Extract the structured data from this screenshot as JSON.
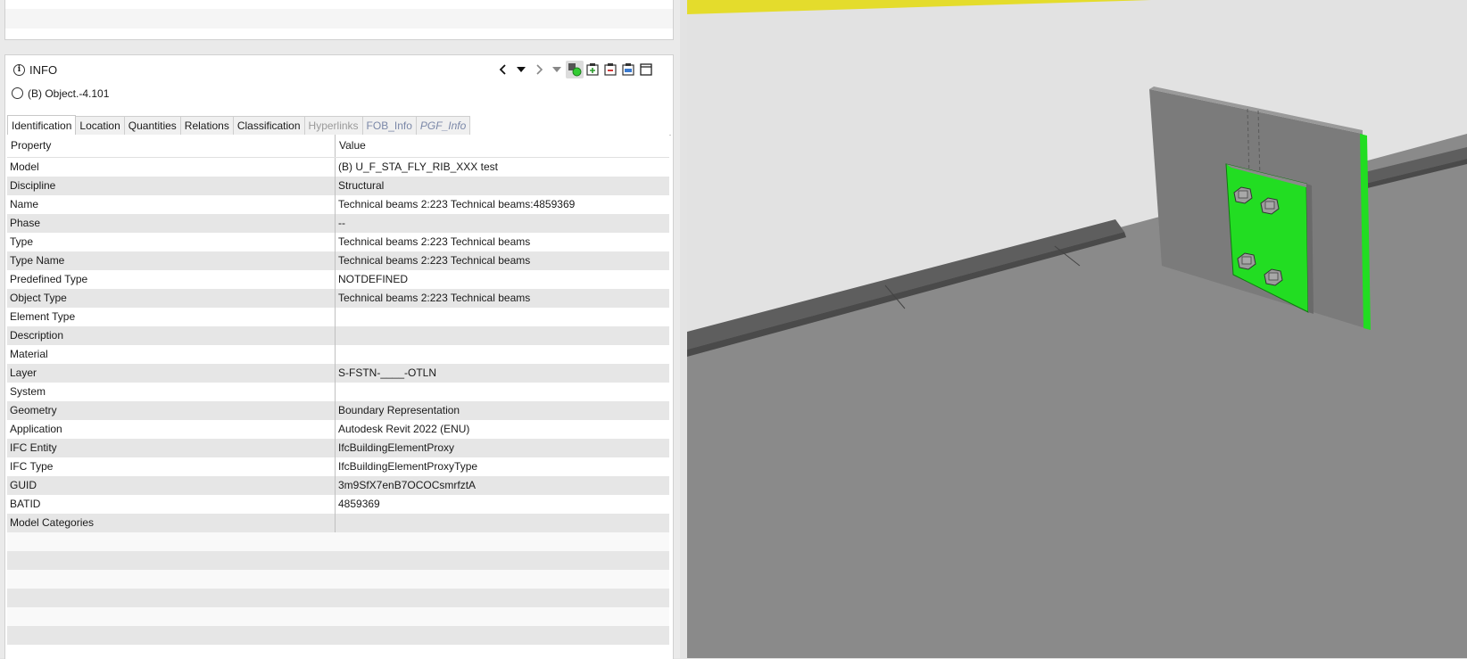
{
  "info_panel": {
    "title": "INFO",
    "object_label": "(B) Object.-4.101",
    "tabs": [
      {
        "label": "Identification"
      },
      {
        "label": "Location"
      },
      {
        "label": "Quantities"
      },
      {
        "label": "Relations"
      },
      {
        "label": "Classification"
      },
      {
        "label": "Hyperlinks"
      },
      {
        "label": "FOB_Info"
      },
      {
        "label": "PGF_Info"
      }
    ],
    "toolbar_icons": [
      "chevron-left-icon",
      "dropdown-arrow-icon",
      "chevron-right-icon",
      "dropdown-arrow-icon",
      "select-objects-icon",
      "add-to-set-icon",
      "remove-from-set-icon",
      "clear-set-icon",
      "window-icon"
    ]
  },
  "grid": {
    "headers": {
      "property": "Property",
      "value": "Value"
    },
    "rows": [
      {
        "property": "Model",
        "value": "(B) U_F_STA_FLY_RIB_XXX test"
      },
      {
        "property": "Discipline",
        "value": "Structural"
      },
      {
        "property": "Name",
        "value": "Technical beams 2:223 Technical beams:4859369"
      },
      {
        "property": "Phase",
        "value": "--"
      },
      {
        "property": "Type",
        "value": "Technical beams 2:223 Technical beams"
      },
      {
        "property": "Type Name",
        "value": "Technical beams 2:223 Technical beams"
      },
      {
        "property": "Predefined Type",
        "value": "NOTDEFINED"
      },
      {
        "property": "Object Type",
        "value": "Technical beams 2:223 Technical beams"
      },
      {
        "property": "Element Type",
        "value": ""
      },
      {
        "property": "Description",
        "value": ""
      },
      {
        "property": "Material",
        "value": ""
      },
      {
        "property": "Layer",
        "value": "S-FSTN-____-OTLN"
      },
      {
        "property": "System",
        "value": ""
      },
      {
        "property": "Geometry",
        "value": "Boundary Representation"
      },
      {
        "property": "Application",
        "value": "Autodesk Revit 2022 (ENU)"
      },
      {
        "property": "IFC Entity",
        "value": "IfcBuildingElementProxy"
      },
      {
        "property": "IFC Type",
        "value": "IfcBuildingElementProxyType"
      },
      {
        "property": "GUID",
        "value": "3m9SfX7enB7OCOCsmrfztA"
      },
      {
        "property": "BATID",
        "value": "4859369"
      },
      {
        "property": "Model Categories",
        "value": ""
      }
    ]
  },
  "colors": {
    "highlight_green": "#22dd22",
    "steel_gray": "#7a7a7a",
    "floor_gray": "#8c8c8c",
    "yellow_edge": "#e5dc2a"
  }
}
